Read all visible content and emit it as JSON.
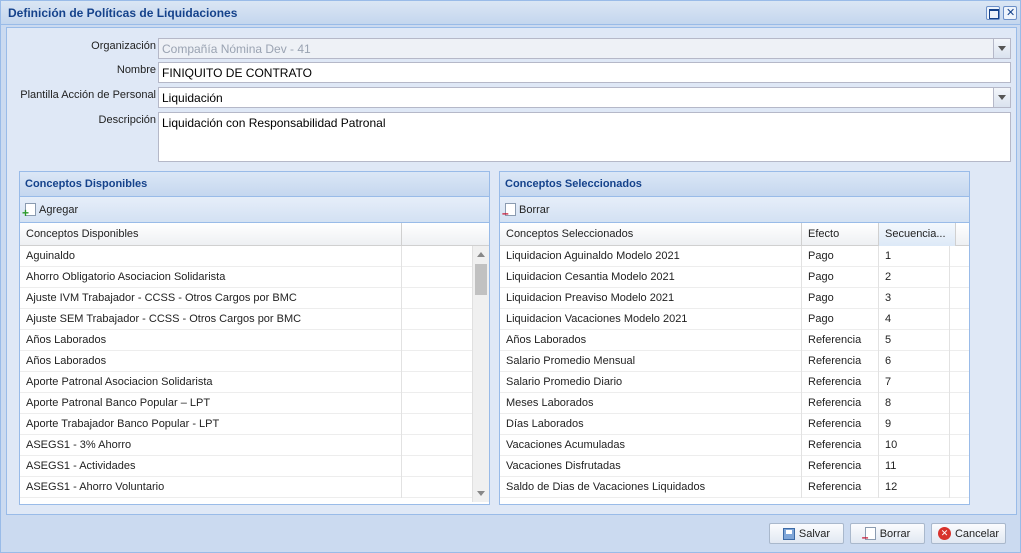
{
  "window": {
    "title": "Definición de Políticas de Liquidaciones"
  },
  "form": {
    "organizacion_label": "Organización",
    "organizacion_value": "Compañía Nómina Dev - 41",
    "nombre_label": "Nombre",
    "nombre_value": "FINIQUITO DE CONTRATO",
    "plantilla_label": "Plantilla Acción de Personal",
    "plantilla_value": "Liquidación",
    "descripcion_label": "Descripción",
    "descripcion_value": "Liquidación con Responsabilidad Patronal"
  },
  "disponibles": {
    "title": "Conceptos Disponibles",
    "add_label": "Agregar",
    "column": "Conceptos Disponibles",
    "rows": [
      "Aguinaldo",
      "Ahorro Obligatorio Asociacion Solidarista",
      "Ajuste IVM Trabajador - CCSS - Otros Cargos por BMC",
      "Ajuste SEM Trabajador - CCSS - Otros Cargos por BMC",
      "Años Laborados",
      "Años Laborados",
      "Aporte Patronal Asociacion Solidarista",
      "Aporte Patronal Banco Popular – LPT",
      "Aporte Trabajador Banco Popular - LPT",
      "ASEGS1 - 3% Ahorro",
      "ASEGS1 - Actividades",
      "ASEGS1 - Ahorro Voluntario"
    ]
  },
  "seleccionados": {
    "title": "Conceptos Seleccionados",
    "delete_label": "Borrar",
    "columns": [
      "Conceptos Seleccionados",
      "Efecto",
      "Secuencia..."
    ],
    "rows": [
      [
        "Liquidacion Aguinaldo Modelo 2021",
        "Pago",
        "1"
      ],
      [
        "Liquidacion Cesantia Modelo 2021",
        "Pago",
        "2"
      ],
      [
        "Liquidacion Preaviso Modelo 2021",
        "Pago",
        "3"
      ],
      [
        "Liquidacion Vacaciones Modelo 2021",
        "Pago",
        "4"
      ],
      [
        "Años Laborados",
        "Referencia",
        "5"
      ],
      [
        "Salario Promedio Mensual",
        "Referencia",
        "6"
      ],
      [
        "Salario Promedio Diario",
        "Referencia",
        "7"
      ],
      [
        "Meses Laborados",
        "Referencia",
        "8"
      ],
      [
        "Días Laborados",
        "Referencia",
        "9"
      ],
      [
        "Vacaciones Acumuladas",
        "Referencia",
        "10"
      ],
      [
        "Vacaciones Disfrutadas",
        "Referencia",
        "11"
      ],
      [
        "Saldo de Dias de Vacaciones Liquidados",
        "Referencia",
        "12"
      ]
    ]
  },
  "footer": {
    "save_label": "Salvar",
    "delete_label": "Borrar",
    "cancel_label": "Cancelar"
  }
}
